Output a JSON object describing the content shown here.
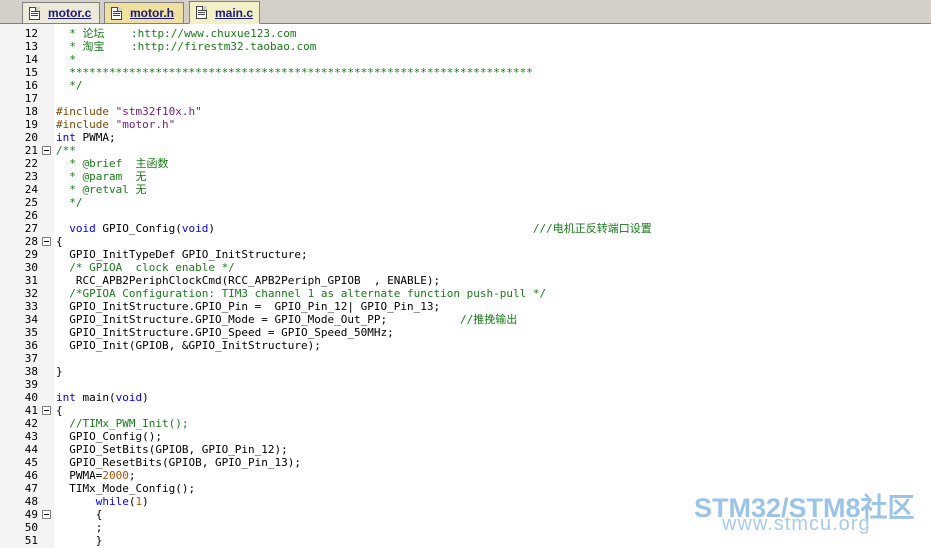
{
  "tabs": [
    {
      "label": "motor.c",
      "active": false
    },
    {
      "label": "motor.h",
      "active": false
    },
    {
      "label": "main.c",
      "active": true
    }
  ],
  "lines": [
    {
      "n": "12",
      "segs": [
        {
          "t": "  * 论坛    :http://www.chuxue123.com",
          "c": "c"
        }
      ]
    },
    {
      "n": "13",
      "segs": [
        {
          "t": "  * 淘宝    :http://firestm32.taobao.com",
          "c": "c"
        }
      ]
    },
    {
      "n": "14",
      "segs": [
        {
          "t": "  *",
          "c": "c"
        }
      ]
    },
    {
      "n": "15",
      "segs": [
        {
          "t": "  **********************************************************************",
          "c": "c"
        }
      ]
    },
    {
      "n": "16",
      "segs": [
        {
          "t": "  */",
          "c": "c"
        }
      ]
    },
    {
      "n": "17",
      "segs": []
    },
    {
      "n": "18",
      "segs": [
        {
          "t": "#include ",
          "c": "p"
        },
        {
          "t": "\"stm32f10x.h\"",
          "c": "s"
        }
      ]
    },
    {
      "n": "19",
      "segs": [
        {
          "t": "#include ",
          "c": "p"
        },
        {
          "t": "\"motor.h\"",
          "c": "s"
        }
      ]
    },
    {
      "n": "20",
      "segs": [
        {
          "t": "int",
          "c": "k"
        },
        {
          "t": " PWMA;",
          "c": ""
        }
      ]
    },
    {
      "n": "21",
      "fold": true,
      "segs": [
        {
          "t": "/**",
          "c": "c"
        }
      ]
    },
    {
      "n": "22",
      "segs": [
        {
          "t": "  * @brief  主函数",
          "c": "c"
        }
      ]
    },
    {
      "n": "23",
      "segs": [
        {
          "t": "  * @param  无",
          "c": "c"
        }
      ]
    },
    {
      "n": "24",
      "segs": [
        {
          "t": "  * @retval 无",
          "c": "c"
        }
      ]
    },
    {
      "n": "25",
      "segs": [
        {
          "t": "  */",
          "c": "c"
        }
      ]
    },
    {
      "n": "26",
      "segs": []
    },
    {
      "n": "27",
      "segs": [
        {
          "t": "  void",
          "c": "k"
        },
        {
          "t": " GPIO_Config(",
          "c": ""
        },
        {
          "t": "void",
          "c": "k"
        },
        {
          "t": ")                                                ",
          "c": ""
        },
        {
          "t": "///电机正反转端口设置",
          "c": "c"
        }
      ]
    },
    {
      "n": "28",
      "fold": true,
      "segs": [
        {
          "t": "{",
          "c": ""
        }
      ]
    },
    {
      "n": "29",
      "segs": [
        {
          "t": "  GPIO_InitTypeDef GPIO_InitStructure;",
          "c": ""
        }
      ]
    },
    {
      "n": "30",
      "segs": [
        {
          "t": "  /* GPIOA  clock enable */",
          "c": "c"
        }
      ]
    },
    {
      "n": "31",
      "segs": [
        {
          "t": "   RCC_APB2PeriphClockCmd(RCC_APB2Periph_GPIOB  , ENABLE);",
          "c": ""
        }
      ]
    },
    {
      "n": "32",
      "segs": [
        {
          "t": "  /*GPIOA Configuration: TIM3 channel 1 as alternate function push-pull */",
          "c": "c"
        }
      ]
    },
    {
      "n": "33",
      "segs": [
        {
          "t": "  GPIO_InitStructure.GPIO_Pin =  GPIO_Pin_12| GPIO_Pin_13;",
          "c": ""
        }
      ]
    },
    {
      "n": "34",
      "segs": [
        {
          "t": "  GPIO_InitStructure.GPIO_Mode = GPIO_Mode_Out_PP;           ",
          "c": ""
        },
        {
          "t": "//推挽输出",
          "c": "c"
        }
      ]
    },
    {
      "n": "35",
      "segs": [
        {
          "t": "  GPIO_InitStructure.GPIO_Speed = GPIO_Speed_50MHz;",
          "c": ""
        }
      ]
    },
    {
      "n": "36",
      "segs": [
        {
          "t": "  GPIO_Init(GPIOB, &GPIO_InitStructure);",
          "c": ""
        }
      ]
    },
    {
      "n": "37",
      "segs": []
    },
    {
      "n": "38",
      "segs": [
        {
          "t": "}",
          "c": ""
        }
      ]
    },
    {
      "n": "39",
      "segs": []
    },
    {
      "n": "40",
      "segs": [
        {
          "t": "int",
          "c": "k"
        },
        {
          "t": " main(",
          "c": ""
        },
        {
          "t": "void",
          "c": "k"
        },
        {
          "t": ")",
          "c": ""
        }
      ]
    },
    {
      "n": "41",
      "fold": true,
      "segs": [
        {
          "t": "{",
          "c": ""
        }
      ]
    },
    {
      "n": "42",
      "segs": [
        {
          "t": "  //TIMx_PWM_Init();",
          "c": "c"
        }
      ]
    },
    {
      "n": "43",
      "segs": [
        {
          "t": "  GPIO_Config();",
          "c": ""
        }
      ]
    },
    {
      "n": "44",
      "segs": [
        {
          "t": "  GPIO_SetBits(GPIOB, GPIO_Pin_12);",
          "c": ""
        }
      ]
    },
    {
      "n": "45",
      "segs": [
        {
          "t": "  GPIO_ResetBits(GPIOB, GPIO_Pin_13);",
          "c": ""
        }
      ]
    },
    {
      "n": "46",
      "segs": [
        {
          "t": "  PWMA=",
          "c": ""
        },
        {
          "t": "2000",
          "c": "n"
        },
        {
          "t": ";",
          "c": ""
        }
      ]
    },
    {
      "n": "47",
      "segs": [
        {
          "t": "  TIMx_Mode_Config();",
          "c": ""
        }
      ]
    },
    {
      "n": "48",
      "segs": [
        {
          "t": "      ",
          "c": ""
        },
        {
          "t": "while",
          "c": "k"
        },
        {
          "t": "(",
          "c": ""
        },
        {
          "t": "1",
          "c": "n"
        },
        {
          "t": ")",
          "c": ""
        }
      ]
    },
    {
      "n": "49",
      "fold": true,
      "segs": [
        {
          "t": "      {",
          "c": ""
        }
      ]
    },
    {
      "n": "50",
      "segs": [
        {
          "t": "      ;",
          "c": ""
        }
      ]
    },
    {
      "n": "51",
      "segs": [
        {
          "t": "      }",
          "c": ""
        }
      ]
    }
  ],
  "watermark": {
    "line1": "STM32/STM8社区",
    "line2": "www.stmcu.org"
  }
}
